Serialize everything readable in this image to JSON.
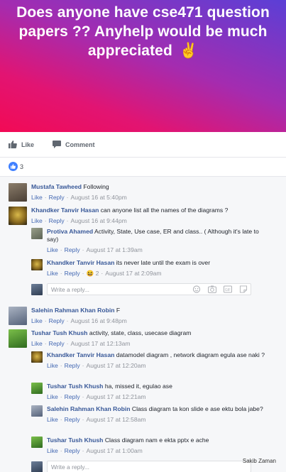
{
  "post": {
    "text": "Does anyone have cse471 question papers ?? Anyhelp would be much appreciated",
    "emoji": "✌"
  },
  "actions": {
    "like_label": "Like",
    "comment_label": "Comment"
  },
  "reactions": {
    "count": "3"
  },
  "comments": [
    {
      "author": "Mustafa Tawheed",
      "text": "Following",
      "like": "Like",
      "reply": "Reply",
      "time": "August 16 at 5:40pm"
    },
    {
      "author": "Khandker Tanvir Hasan",
      "text": "can anyone list all the names of the diagrams ?",
      "like": "Like",
      "reply": "Reply",
      "time": "August 16 at 9:44pm",
      "replies": [
        {
          "author": "Protiva Ahamed",
          "text": "Activity, State, Use case, ER and class.. ( Although it's late to say)",
          "like": "Like",
          "reply": "Reply",
          "time": "August 17 at 1:39am"
        },
        {
          "author": "Khandker Tanvir Hasan",
          "text": "its never late until the exam is over",
          "like": "Like",
          "reply": "Reply",
          "reaction_count": "2",
          "time": "August 17 at 2:09am"
        }
      ]
    },
    {
      "author": "Salehin Rahman Khan Robin",
      "text": "F",
      "like": "Like",
      "reply": "Reply",
      "time": "August 16 at 9:48pm"
    },
    {
      "author": "Tushar Tush Khush",
      "text": "activity, state, class, usecase diagram",
      "like": "Like",
      "reply": "Reply",
      "time": "August 17 at 12:13am",
      "replies": [
        {
          "author": "Khandker Tanvir Hasan",
          "text": "datamodel diagram , network diagram egula ase naki ?",
          "like": "Like",
          "reply": "Reply",
          "time": "August 17 at 12:20am"
        },
        {
          "author": "Tushar Tush Khush",
          "text": "ha, missed it, egulao ase",
          "like": "Like",
          "reply": "Reply",
          "time": "August 17 at 12:21am"
        },
        {
          "author": "Salehin Rahman Khan Robin",
          "text": "Class diagram ta kon slide e ase ektu bola jabe?",
          "like": "Like",
          "reply": "Reply",
          "time": "August 17 at 12:58am"
        },
        {
          "author": "Tushar Tush Khush",
          "text": "Class diagram nam e ekta pptx e ache",
          "like": "Like",
          "reply": "Reply",
          "time": "August 17 at 1:00am"
        }
      ]
    }
  ],
  "reply_placeholder": "Write a reply...",
  "watermark": "Sakib Zaman"
}
